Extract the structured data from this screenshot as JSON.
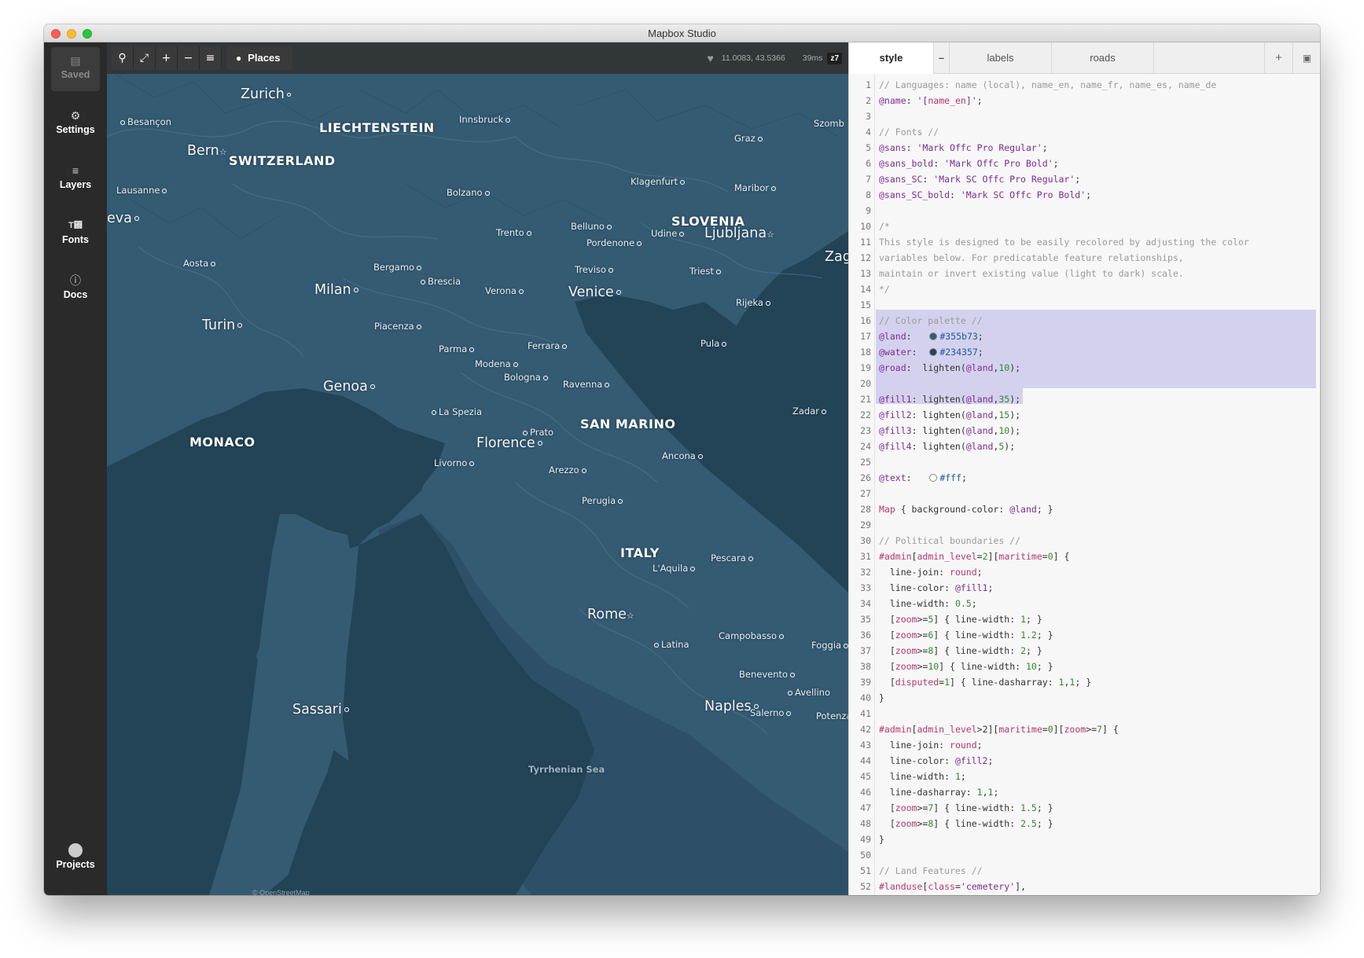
{
  "window": {
    "title": "Mapbox Studio"
  },
  "sidebar": {
    "items": [
      {
        "label": "Saved",
        "icon": "save-icon"
      },
      {
        "label": "Settings",
        "icon": "gear-icon"
      },
      {
        "label": "Layers",
        "icon": "layers-icon"
      },
      {
        "label": "Fonts",
        "icon": "fonts-icon"
      },
      {
        "label": "Docs",
        "icon": "info-icon"
      },
      {
        "label": "Projects",
        "icon": "user-icon"
      }
    ]
  },
  "map": {
    "toolbar": {
      "places_label": "Places"
    },
    "status": {
      "coords": "11.0083, 43.5366",
      "render_time": "39ms",
      "zoom": "z7"
    },
    "labels": {
      "zurich": "Zurich",
      "besancon": "Besançon",
      "liechtenstein": "LIECHTENSTEIN",
      "innsbruck": "Innsbruck",
      "szombathely": "Szomb",
      "graz": "Graz",
      "bern": "Bern",
      "switzerland": "SWITZERLAND",
      "klagenfurt": "Klagenfurt",
      "maribor": "Maribor",
      "lausanne": "Lausanne",
      "bolzano": "Bolzano",
      "geneva": "eva",
      "slovenia": "SLOVENIA",
      "belluno": "Belluno",
      "udine": "Udine",
      "trento": "Trento",
      "ljubljana": "Ljubljana",
      "zagreb": "Zagreb",
      "pordenone": "Pordenone",
      "aosta": "Aosta",
      "bergamo": "Bergamo",
      "treviso": "Treviso",
      "triest": "Triest",
      "brescia": "Brescia",
      "milan": "Milan",
      "verona": "Verona",
      "venice": "Venice",
      "rijeka": "Rijeka",
      "turin": "Turin",
      "piacenza": "Piacenza",
      "pula": "Pula",
      "parma": "Parma",
      "ferrara": "Ferrara",
      "modena": "Modena",
      "bologna": "Bologna",
      "genoa": "Genoa",
      "ravenna": "Ravenna",
      "la_spezia": "La Spezia",
      "zadar": "Zadar",
      "prato": "Prato",
      "san_marino": "SAN MARINO",
      "monaco": "MONACO",
      "florence": "Florence",
      "ancona": "Ancona",
      "livorno": "Livorno",
      "arezzo": "Arezzo",
      "perugia": "Perugia",
      "italy": "ITALY",
      "pescara": "Pescara",
      "laquila": "L'Aquila",
      "rome": "Rome",
      "campobasso": "Campobasso",
      "latina": "Latina",
      "foggia": "Foggia",
      "benevento": "Benevento",
      "avellino": "Avellino",
      "sassari": "Sassari",
      "naples": "Naples",
      "salerno": "Salerno",
      "potenza": "Potenza",
      "tyrrhenian": "Tyrrhenian Sea",
      "attribution": "© OpenStreetMap"
    }
  },
  "editor": {
    "tabs": [
      {
        "label": "style",
        "active": true
      },
      {
        "label": "labels",
        "active": false
      },
      {
        "label": "roads",
        "active": false
      }
    ],
    "tab_minus": "–",
    "tab_add": "+",
    "highlight_color": "#d4d1ee",
    "lines": [
      "1",
      "2",
      "3",
      "4",
      "5",
      "6",
      "7",
      "8",
      "9",
      "10",
      "11",
      "12",
      "13",
      "14",
      "15",
      "16",
      "17",
      "18",
      "19",
      "20",
      "21",
      "22",
      "23",
      "24",
      "25",
      "26",
      "27",
      "28",
      "29",
      "30",
      "31",
      "32",
      "33",
      "34",
      "35",
      "36",
      "37",
      "38",
      "39",
      "40",
      "41",
      "42",
      "43",
      "44",
      "45",
      "46",
      "47",
      "48",
      "49",
      "50",
      "51",
      "52"
    ],
    "code": [
      "// Languages: name (local), name_en, name_fr, name_es, name_de",
      "@name: '[name_en]';",
      "",
      "// Fonts //",
      "@sans: 'Mark Offc Pro Regular';",
      "@sans_bold: 'Mark Offc Pro Bold';",
      "@sans_SC: 'Mark SC Offc Pro Regular';",
      "@sans_SC_bold: 'Mark SC Offc Pro Bold';",
      "",
      "/*",
      "This style is designed to be easily recolored by adjusting the color",
      "variables below. For predicatable feature relationships,",
      "maintain or invert existing value (light to dark) scale.",
      "*/",
      "",
      "// Color palette //",
      "@land:   #355b73;",
      "@water:  #234357;",
      "@road:  lighten(@land,10);",
      "",
      "@fill1: lighten(@land,35);",
      "@fill2: lighten(@land,15);",
      "@fill3: lighten(@land,10);",
      "@fill4: lighten(@land,5);",
      "",
      "@text:   #fff;",
      "",
      "Map { background-color: @land; }",
      "",
      "// Political boundaries //",
      "#admin[admin_level=2][maritime=0] {",
      "  line-join: round;",
      "  line-color: @fill1;",
      "  line-width: 0.5;",
      "  [zoom>=5] { line-width: 1; }",
      "  [zoom>=6] { line-width: 1.2; }",
      "  [zoom>=8] { line-width: 2; }",
      "  [zoom>=10] { line-width: 10; }",
      "  [disputed=1] { line-dasharray: 1,1; }",
      "}",
      "",
      "#admin[admin_level>2][maritime=0][zoom>=7] {",
      "  line-join: round;",
      "  line-color: @fill2;",
      "  line-width: 1;",
      "  line-dasharray: 1,1;",
      "  [zoom>=7] { line-width: 1.5; }",
      "  [zoom>=8] { line-width: 2.5; }",
      "}",
      "",
      "// Land Features //",
      "#landuse[class='cemetery'],"
    ],
    "swatches": {
      "land": "#355b73",
      "water": "#234357",
      "text": "#fff"
    }
  }
}
